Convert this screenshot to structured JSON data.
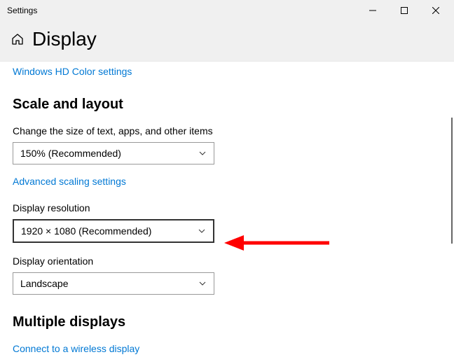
{
  "window": {
    "title": "Settings"
  },
  "page": {
    "title": "Display"
  },
  "links": {
    "hd_color": "Windows HD Color settings",
    "advanced_scaling": "Advanced scaling settings",
    "wireless_display": "Connect to a wireless display"
  },
  "sections": {
    "scale_layout": "Scale and layout",
    "multiple_displays": "Multiple displays"
  },
  "fields": {
    "scale": {
      "label": "Change the size of text, apps, and other items",
      "value": "150% (Recommended)"
    },
    "resolution": {
      "label": "Display resolution",
      "value": "1920 × 1080 (Recommended)"
    },
    "orientation": {
      "label": "Display orientation",
      "value": "Landscape"
    }
  },
  "colors": {
    "accent": "#0078d4",
    "arrow": "#ff0000"
  }
}
